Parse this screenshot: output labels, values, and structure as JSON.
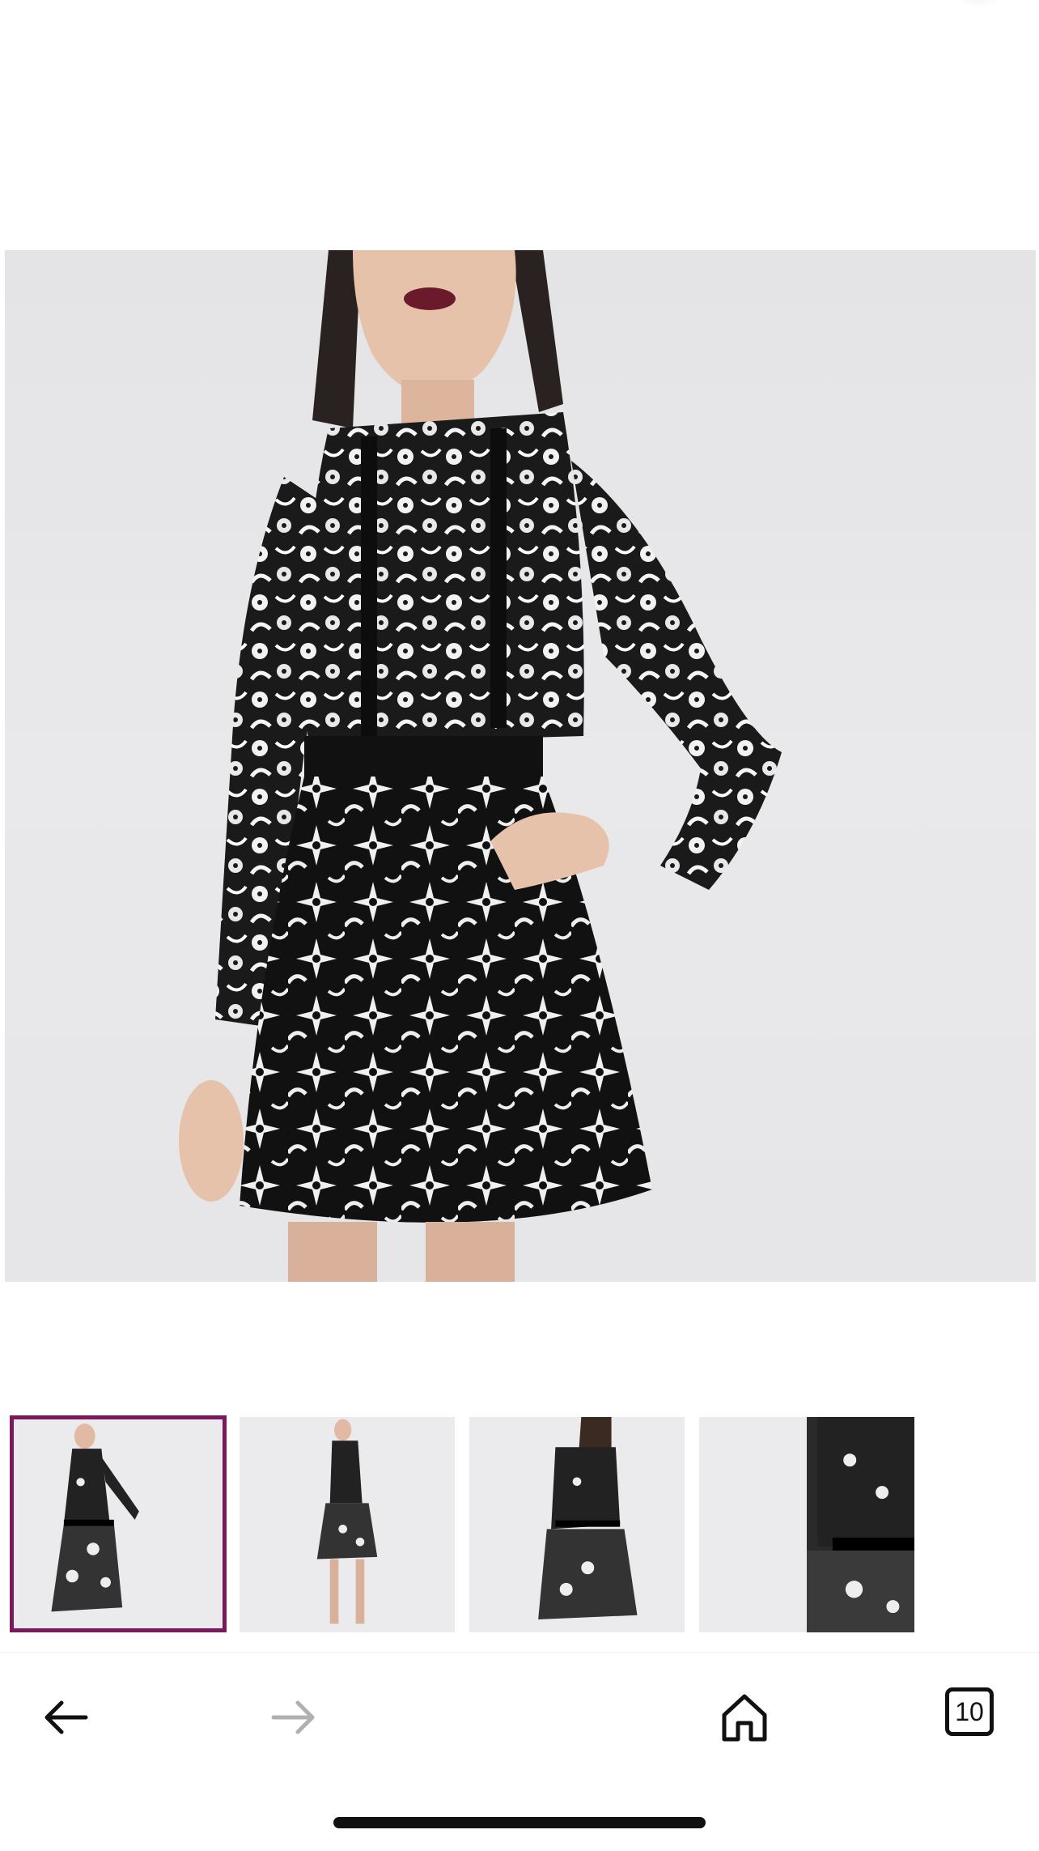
{
  "product_images": {
    "main": "main-product-photo",
    "thumbnails": [
      {
        "id": "thumb-1",
        "selected": true
      },
      {
        "id": "thumb-2",
        "selected": false
      },
      {
        "id": "thumb-3",
        "selected": false
      },
      {
        "id": "thumb-4",
        "selected": false
      },
      {
        "id": "thumb-5",
        "selected": false
      }
    ]
  },
  "toolbar": {
    "back_icon": "arrow-left-icon",
    "forward_icon": "arrow-right-icon",
    "home_icon": "home-icon",
    "tabs_count": "10"
  },
  "colors": {
    "selected_border": "#7a1a5c",
    "icon_active": "#111111",
    "icon_disabled": "#b0b0b4"
  }
}
